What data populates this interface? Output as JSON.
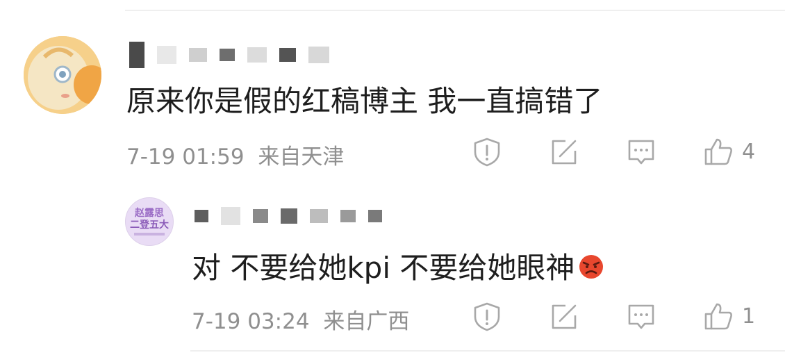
{
  "comment": {
    "text": "原来你是假的红稿博主 我一直搞错了",
    "timestamp": "7-19 01:59",
    "location": "来自天津",
    "like_count": "4"
  },
  "reply": {
    "avatar_text_line1": "赵露思",
    "avatar_text_line2": "二登五大",
    "text": "对 不要给她kpi 不要给她眼神",
    "emoji_icon": "angry-face-icon",
    "timestamp": "7-19 03:24",
    "location": "来自广西",
    "like_count": "1"
  },
  "icons": {
    "report": "report-shield-icon",
    "share": "share-icon",
    "comment": "comment-icon",
    "like": "thumbs-up-icon"
  },
  "colors": {
    "meta_text": "#8f8f8f",
    "icon_stroke": "#b0b0b0",
    "avatar_orange": "#f0a545",
    "avatar_purple": "#e9dcf5"
  }
}
